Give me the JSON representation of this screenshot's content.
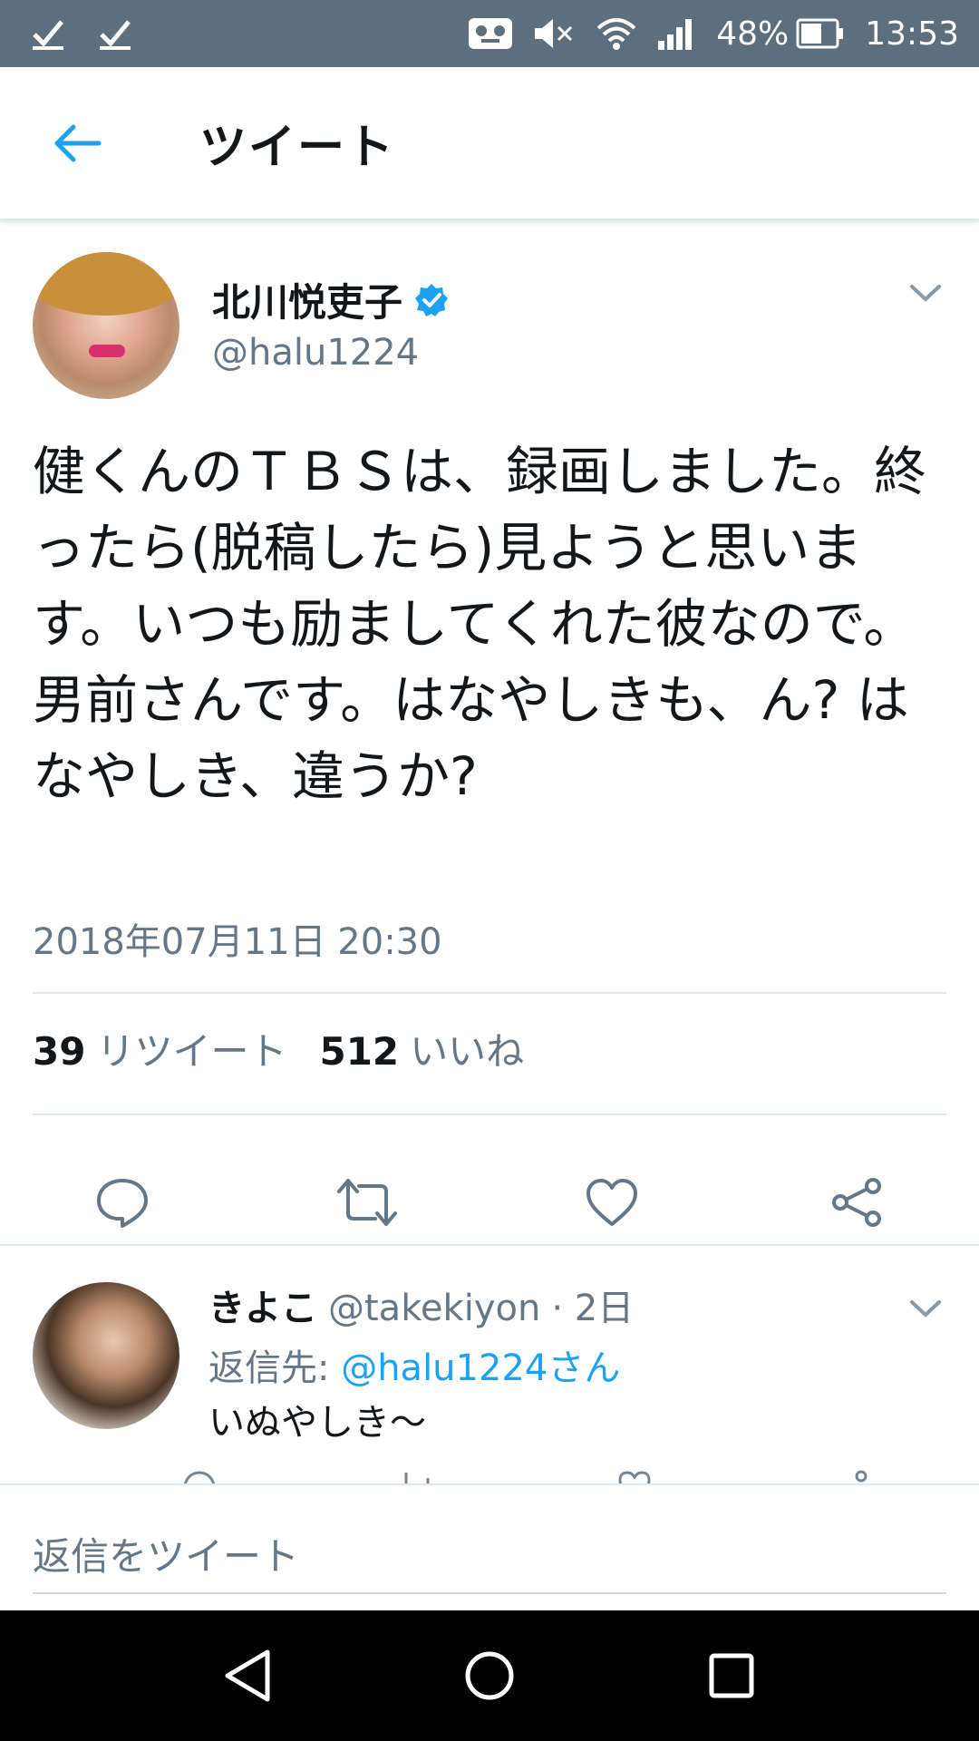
{
  "status_bar": {
    "battery": "48%",
    "time": "13:53",
    "icons": [
      "check-icon",
      "check-icon",
      "voicemail-icon",
      "mute-icon",
      "wifi-icon",
      "signal-icon",
      "battery-icon"
    ]
  },
  "app_bar": {
    "title": "ツイート",
    "back_icon": "arrow-left-icon"
  },
  "tweet": {
    "author_name": "北川悦吏子",
    "author_handle": "@halu1224",
    "verified": true,
    "text": "健くんのＴＢＳは、録画しました。終ったら(脱稿したら)見ようと思います。いつも励ましてくれた彼なので。男前さんです。はなやしきも、ん? はなやしき、違うか?",
    "date": "2018年07月11日 20:30",
    "retweet_count": "39",
    "retweet_label": "リツイート",
    "like_count": "512",
    "like_label": "いいね",
    "actions": [
      "reply-icon",
      "retweet-icon",
      "heart-icon",
      "share-icon"
    ]
  },
  "reply": {
    "name": "きよこ",
    "handle": "@takekiyon",
    "time": "· 2日",
    "reply_to_prefix": "返信先: ",
    "reply_to_mention": "@halu1224さん",
    "text": "いぬやしき〜"
  },
  "compose": {
    "placeholder": "返信をツイート"
  },
  "colors": {
    "status_bar": "#5d6e7d",
    "accent": "#1da1f2",
    "secondary_text": "#657786",
    "divider": "#e1e8ed"
  }
}
